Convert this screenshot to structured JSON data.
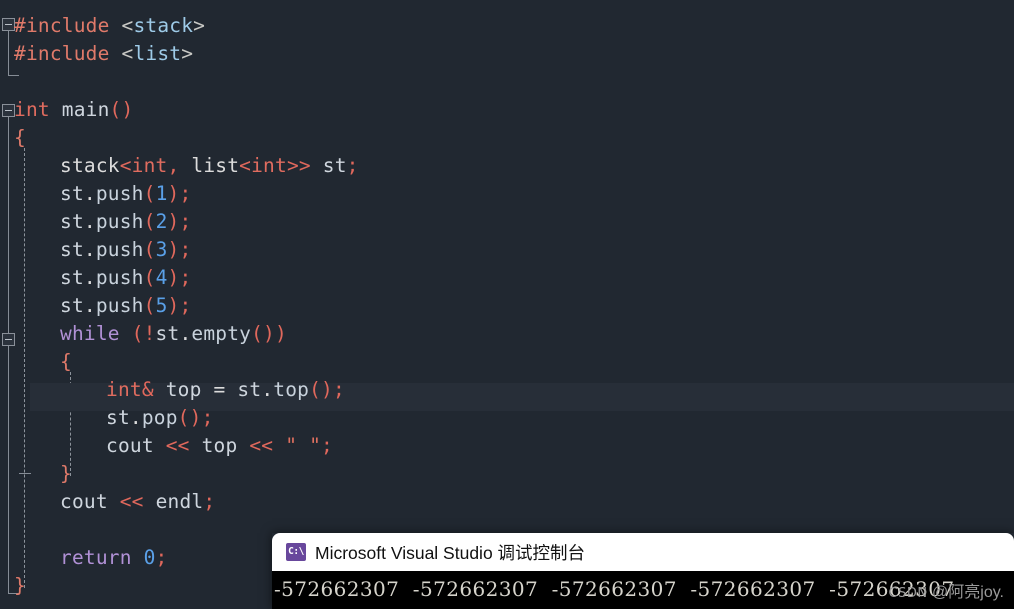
{
  "editor": {
    "background": "#212831",
    "current_line_index": 12,
    "lines": [
      {
        "indent": 0,
        "tokens": [
          {
            "t": "#include",
            "c": "t-pre"
          },
          {
            "t": " ",
            "c": "t-plain"
          },
          {
            "t": "<",
            "c": "t-ang"
          },
          {
            "t": "stack",
            "c": "t-hdr"
          },
          {
            "t": ">",
            "c": "t-ang"
          }
        ]
      },
      {
        "indent": 0,
        "tokens": [
          {
            "t": "#include",
            "c": "t-pre"
          },
          {
            "t": " ",
            "c": "t-plain"
          },
          {
            "t": "<",
            "c": "t-ang"
          },
          {
            "t": "list",
            "c": "t-hdr"
          },
          {
            "t": ">",
            "c": "t-ang"
          }
        ]
      },
      {
        "indent": 0,
        "tokens": []
      },
      {
        "indent": 0,
        "tokens": [
          {
            "t": "int",
            "c": "t-kw"
          },
          {
            "t": " ",
            "c": "t-plain"
          },
          {
            "t": "main",
            "c": "t-id"
          },
          {
            "t": "()",
            "c": "t-punc"
          }
        ]
      },
      {
        "indent": 0,
        "tokens": [
          {
            "t": "{",
            "c": "t-brace"
          }
        ]
      },
      {
        "indent": 1,
        "tokens": [
          {
            "t": "stack",
            "c": "t-plain"
          },
          {
            "t": "<",
            "c": "t-punc"
          },
          {
            "t": "int",
            "c": "t-kw"
          },
          {
            "t": ",",
            "c": "t-punc"
          },
          {
            "t": " ",
            "c": "t-plain"
          },
          {
            "t": "list",
            "c": "t-plain"
          },
          {
            "t": "<",
            "c": "t-punc"
          },
          {
            "t": "int",
            "c": "t-kw"
          },
          {
            "t": ">>",
            "c": "t-punc"
          },
          {
            "t": " ",
            "c": "t-plain"
          },
          {
            "t": "st",
            "c": "t-id"
          },
          {
            "t": ";",
            "c": "t-semi"
          }
        ]
      },
      {
        "indent": 1,
        "tokens": [
          {
            "t": "st",
            "c": "t-id"
          },
          {
            "t": ".",
            "c": "t-plain"
          },
          {
            "t": "push",
            "c": "t-fn"
          },
          {
            "t": "(",
            "c": "t-punc"
          },
          {
            "t": "1",
            "c": "t-num"
          },
          {
            "t": ")",
            "c": "t-punc"
          },
          {
            "t": ";",
            "c": "t-semi"
          }
        ]
      },
      {
        "indent": 1,
        "tokens": [
          {
            "t": "st",
            "c": "t-id"
          },
          {
            "t": ".",
            "c": "t-plain"
          },
          {
            "t": "push",
            "c": "t-fn"
          },
          {
            "t": "(",
            "c": "t-punc"
          },
          {
            "t": "2",
            "c": "t-num"
          },
          {
            "t": ")",
            "c": "t-punc"
          },
          {
            "t": ";",
            "c": "t-semi"
          }
        ]
      },
      {
        "indent": 1,
        "tokens": [
          {
            "t": "st",
            "c": "t-id"
          },
          {
            "t": ".",
            "c": "t-plain"
          },
          {
            "t": "push",
            "c": "t-fn"
          },
          {
            "t": "(",
            "c": "t-punc"
          },
          {
            "t": "3",
            "c": "t-num"
          },
          {
            "t": ")",
            "c": "t-punc"
          },
          {
            "t": ";",
            "c": "t-semi"
          }
        ]
      },
      {
        "indent": 1,
        "tokens": [
          {
            "t": "st",
            "c": "t-id"
          },
          {
            "t": ".",
            "c": "t-plain"
          },
          {
            "t": "push",
            "c": "t-fn"
          },
          {
            "t": "(",
            "c": "t-punc"
          },
          {
            "t": "4",
            "c": "t-num"
          },
          {
            "t": ")",
            "c": "t-punc"
          },
          {
            "t": ";",
            "c": "t-semi"
          }
        ]
      },
      {
        "indent": 1,
        "tokens": [
          {
            "t": "st",
            "c": "t-id"
          },
          {
            "t": ".",
            "c": "t-plain"
          },
          {
            "t": "push",
            "c": "t-fn"
          },
          {
            "t": "(",
            "c": "t-punc"
          },
          {
            "t": "5",
            "c": "t-num"
          },
          {
            "t": ")",
            "c": "t-punc"
          },
          {
            "t": ";",
            "c": "t-semi"
          }
        ]
      },
      {
        "indent": 1,
        "tokens": [
          {
            "t": "while",
            "c": "t-ctl"
          },
          {
            "t": " ",
            "c": "t-plain"
          },
          {
            "t": "(!",
            "c": "t-punc"
          },
          {
            "t": "st",
            "c": "t-id"
          },
          {
            "t": ".",
            "c": "t-plain"
          },
          {
            "t": "empty",
            "c": "t-fn"
          },
          {
            "t": "())",
            "c": "t-punc"
          }
        ]
      },
      {
        "indent": 1,
        "tokens": [
          {
            "t": "{",
            "c": "t-brace"
          }
        ]
      },
      {
        "indent": 2,
        "tokens": [
          {
            "t": "int",
            "c": "t-kw"
          },
          {
            "t": "&",
            "c": "t-punc"
          },
          {
            "t": " ",
            "c": "t-plain"
          },
          {
            "t": "top",
            "c": "t-id"
          },
          {
            "t": " ",
            "c": "t-plain"
          },
          {
            "t": "=",
            "c": "t-plain"
          },
          {
            "t": " ",
            "c": "t-plain"
          },
          {
            "t": "st",
            "c": "t-id"
          },
          {
            "t": ".",
            "c": "t-plain"
          },
          {
            "t": "top",
            "c": "t-fn"
          },
          {
            "t": "()",
            "c": "t-punc"
          },
          {
            "t": ";",
            "c": "t-semi"
          }
        ]
      },
      {
        "indent": 2,
        "tokens": [
          {
            "t": "st",
            "c": "t-id"
          },
          {
            "t": ".",
            "c": "t-plain"
          },
          {
            "t": "pop",
            "c": "t-fn"
          },
          {
            "t": "()",
            "c": "t-punc"
          },
          {
            "t": ";",
            "c": "t-semi"
          }
        ]
      },
      {
        "indent": 2,
        "tokens": [
          {
            "t": "cout",
            "c": "t-id"
          },
          {
            "t": " ",
            "c": "t-plain"
          },
          {
            "t": "<<",
            "c": "t-op"
          },
          {
            "t": " ",
            "c": "t-plain"
          },
          {
            "t": "top",
            "c": "t-id"
          },
          {
            "t": " ",
            "c": "t-plain"
          },
          {
            "t": "<<",
            "c": "t-op"
          },
          {
            "t": " ",
            "c": "t-plain"
          },
          {
            "t": "\" \"",
            "c": "t-str"
          },
          {
            "t": ";",
            "c": "t-semi"
          }
        ]
      },
      {
        "indent": 1,
        "tokens": [
          {
            "t": "}",
            "c": "t-brace"
          }
        ]
      },
      {
        "indent": 1,
        "tokens": [
          {
            "t": "cout",
            "c": "t-id"
          },
          {
            "t": " ",
            "c": "t-plain"
          },
          {
            "t": "<<",
            "c": "t-op"
          },
          {
            "t": " ",
            "c": "t-plain"
          },
          {
            "t": "endl",
            "c": "t-id"
          },
          {
            "t": ";",
            "c": "t-semi"
          }
        ]
      },
      {
        "indent": 1,
        "tokens": []
      },
      {
        "indent": 1,
        "tokens": [
          {
            "t": "return",
            "c": "t-ctl"
          },
          {
            "t": " ",
            "c": "t-plain"
          },
          {
            "t": "0",
            "c": "t-num"
          },
          {
            "t": ";",
            "c": "t-semi"
          }
        ]
      },
      {
        "indent": 0,
        "tokens": [
          {
            "t": "}",
            "c": "t-brace"
          }
        ]
      }
    ],
    "plain_lines": [
      "#include <stack>",
      "#include <list>",
      "",
      "int main()",
      "{",
      "    stack<int, list<int>> st;",
      "    st.push(1);",
      "    st.push(2);",
      "    st.push(3);",
      "    st.push(4);",
      "    st.push(5);",
      "    while (!st.empty())",
      "    {",
      "        int& top = st.top();",
      "        st.pop();",
      "        cout << top << \" \";",
      "    }",
      "    cout << endl;",
      "",
      "    return 0;",
      "}"
    ]
  },
  "console": {
    "icon_label": "C:\\",
    "icon_name": "console-app-icon",
    "title": "Microsoft Visual Studio 调试控制台",
    "output_line": "-572662307  -572662307  -572662307  -572662307  -572662307"
  },
  "watermark": {
    "brand": "CSDN",
    "author": "@阿亮joy."
  }
}
